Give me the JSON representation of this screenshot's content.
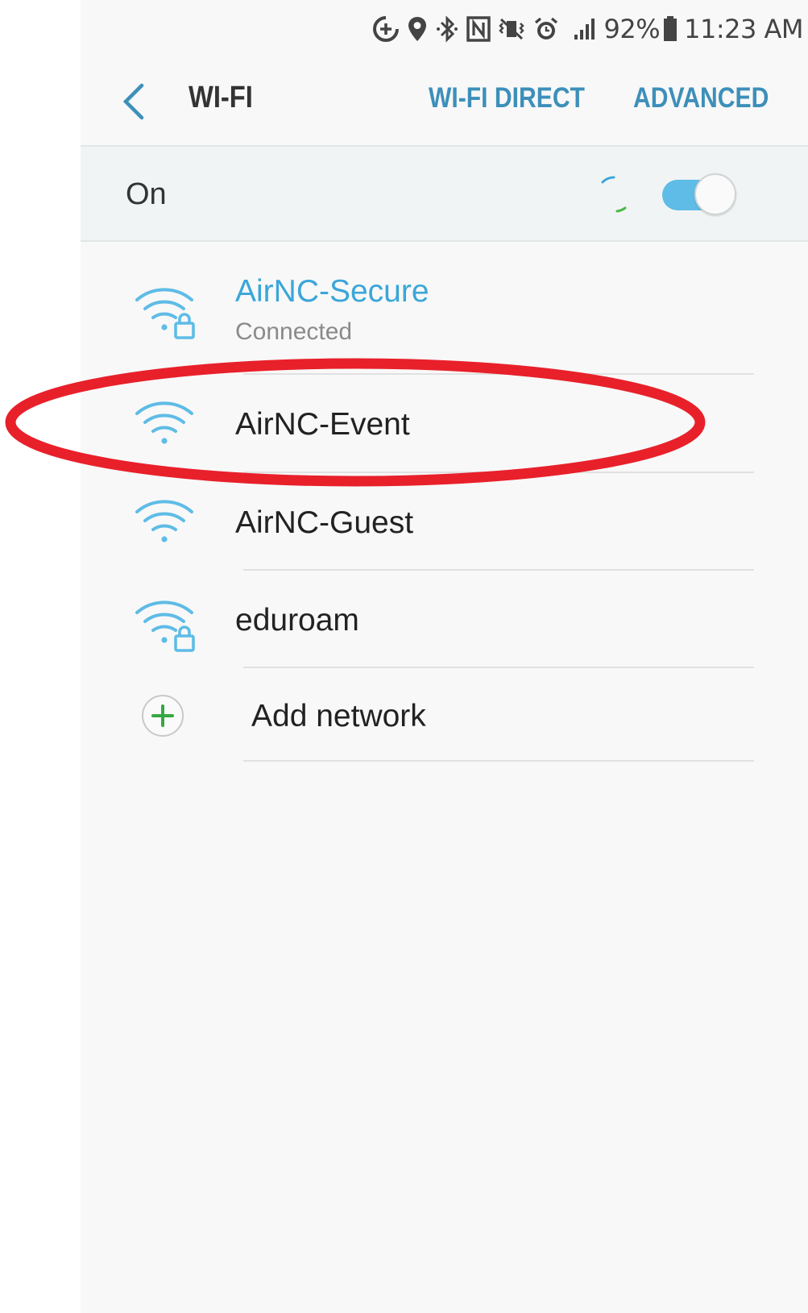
{
  "status_bar": {
    "icons": [
      "data-saver-icon",
      "location-icon",
      "bluetooth-icon",
      "nfc-icon",
      "vibrate-icon",
      "alarm-icon",
      "signal-icon"
    ],
    "battery_percent": "92%",
    "time": "11:23 AM"
  },
  "header": {
    "title": "WI-FI",
    "actions": {
      "wifi_direct": "WI-FI DIRECT",
      "advanced": "ADVANCED"
    }
  },
  "wifi_toggle": {
    "label": "On",
    "enabled": true
  },
  "networks": [
    {
      "name": "AirNC-Secure",
      "status": "Connected",
      "secured": true,
      "connected": true
    },
    {
      "name": "AirNC-Event",
      "status": "",
      "secured": false,
      "connected": false,
      "highlighted": true
    },
    {
      "name": "AirNC-Guest",
      "status": "",
      "secured": false,
      "connected": false
    },
    {
      "name": "eduroam",
      "status": "",
      "secured": true,
      "connected": false
    }
  ],
  "add_network": {
    "label": "Add network"
  },
  "colors": {
    "accent": "#3d8fba",
    "wifi_icon": "#5ebce6",
    "toggle_on": "#5ebce6",
    "highlight_ring": "#e8202a",
    "add_plus": "#35a845"
  }
}
